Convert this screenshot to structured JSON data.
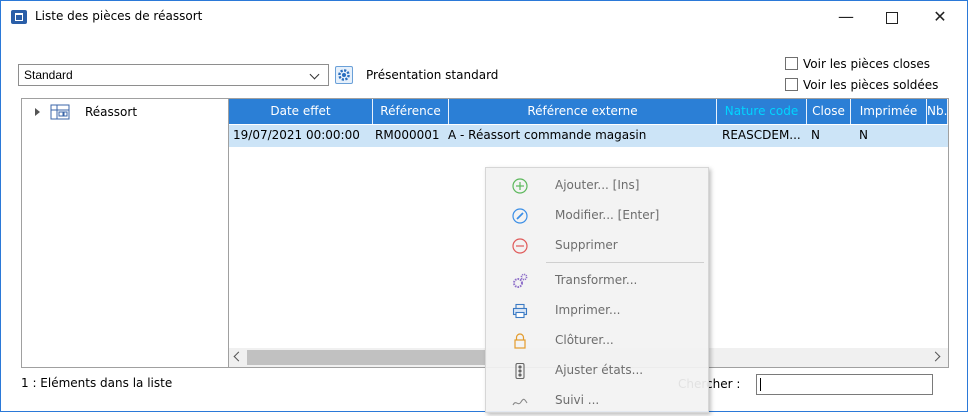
{
  "window": {
    "title": "Liste des pièces de réassort",
    "controls": {
      "minimize": "—",
      "close": "✕"
    }
  },
  "toolbar": {
    "presentation_value": "Standard",
    "presentation_label": "Présentation standard",
    "show_closed_label": "Voir les pièces closes",
    "show_settled_label": "Voir les pièces soldées",
    "show_closed_checked": false,
    "show_settled_checked": false
  },
  "tree": {
    "root_label": "Réassort"
  },
  "grid": {
    "columns": [
      "Date effet",
      "Référence",
      "Référence externe",
      "Nature code",
      "Close",
      "Imprimée",
      "Nb."
    ],
    "rows": [
      {
        "date": "19/07/2021 00:00:00",
        "reference": "RM000001",
        "external_reference": "A - Réassort commande magasin",
        "nature_code": "REASCDEM...",
        "close": "N",
        "printed": "N"
      }
    ]
  },
  "status": {
    "count_text": "1 : Eléments dans la liste",
    "search_label": "Chercher :",
    "search_value": ""
  },
  "context_menu": {
    "items": [
      {
        "label": "Ajouter... [Ins]",
        "icon": "add-circle-icon",
        "color": "#5cb85c"
      },
      {
        "label": "Modifier... [Enter]",
        "icon": "edit-circle-icon",
        "color": "#3a8ee6"
      },
      {
        "label": "Supprimer",
        "icon": "remove-circle-icon",
        "color": "#e05a5a"
      },
      {
        "label": "Transformer...",
        "icon": "gears-icon",
        "color": "#8e6fc9"
      },
      {
        "label": "Imprimer...",
        "icon": "printer-icon",
        "color": "#3a7ac4"
      },
      {
        "label": "Clôturer...",
        "icon": "padlock-icon",
        "color": "#e39b2c"
      },
      {
        "label": "Ajuster états...",
        "icon": "traffic-light-icon",
        "color": "#666666"
      },
      {
        "label": "Suivi ...",
        "icon": "flow-icon",
        "color": "#888888"
      }
    ]
  },
  "colors": {
    "header": "#2b7fd6",
    "selected_row": "#cce4f7",
    "sorted_column_text": "#00d5ff"
  }
}
